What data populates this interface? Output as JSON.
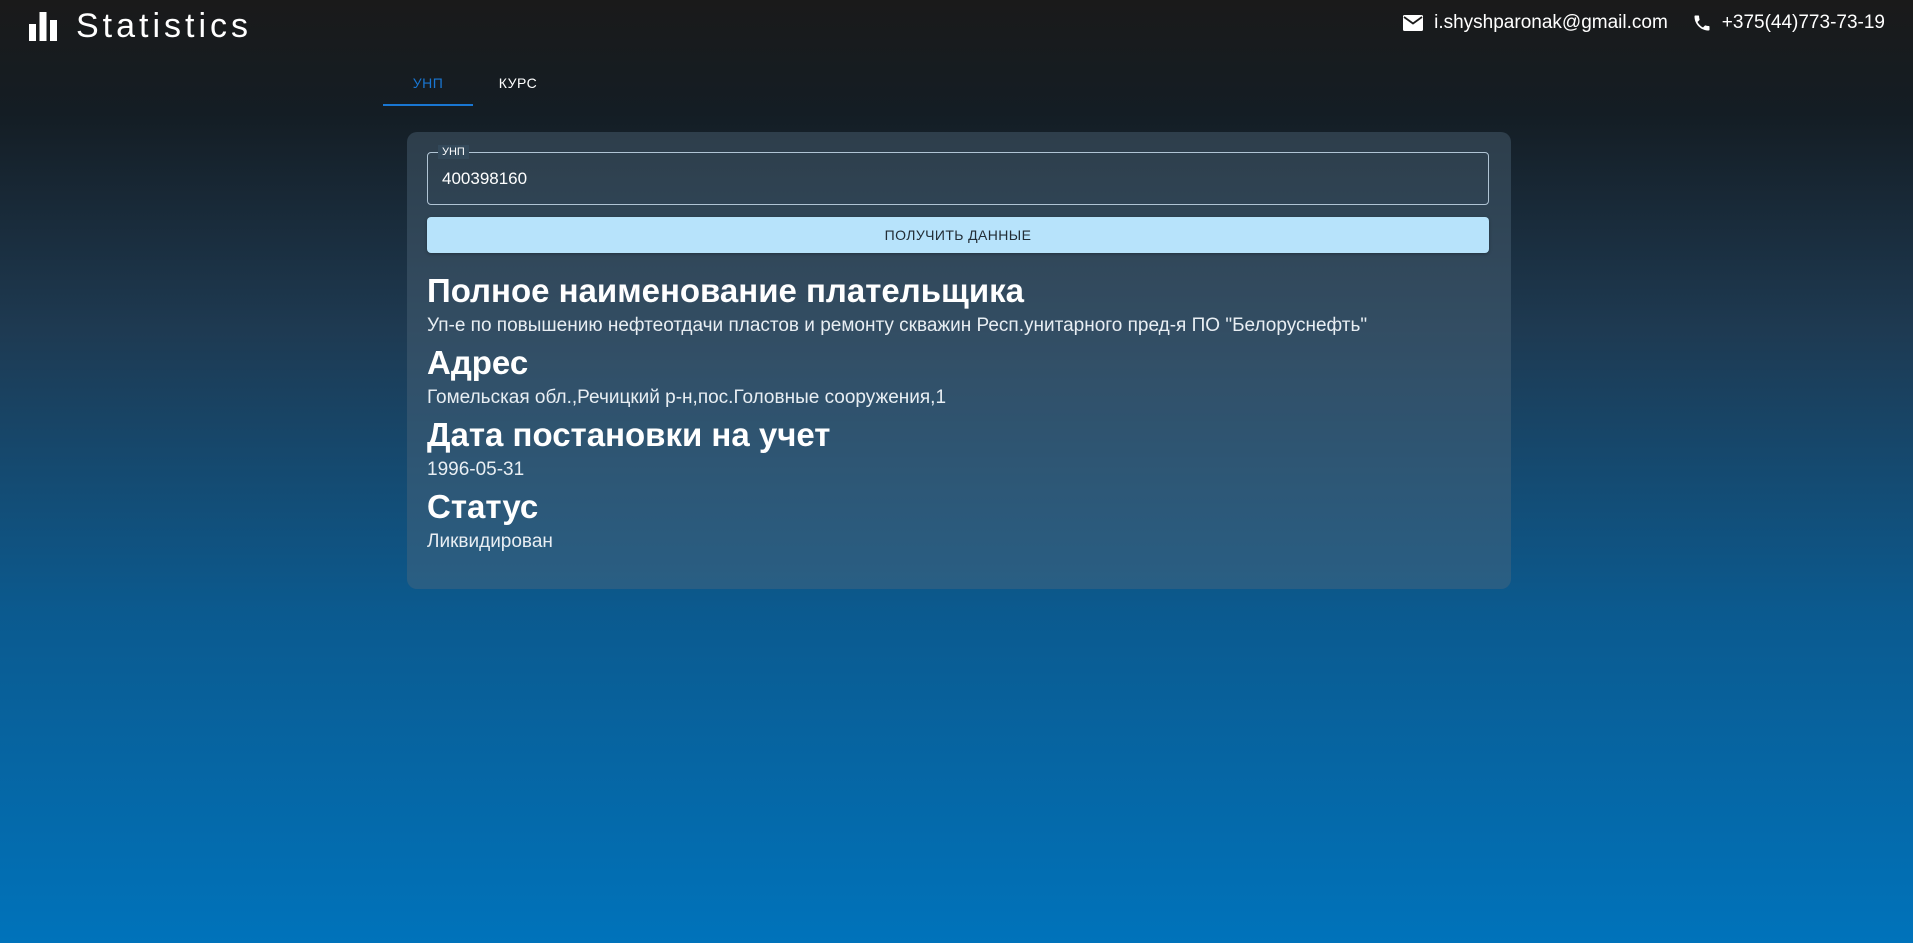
{
  "header": {
    "title": "Statistics",
    "email": "i.shyshparonak@gmail.com",
    "phone": "+375(44)773-73-19"
  },
  "tabs": [
    {
      "label": "УНП",
      "active": true
    },
    {
      "label": "КУРС",
      "active": false
    }
  ],
  "form": {
    "field_label": "УНП",
    "field_value": "400398160",
    "button_label": "ПОЛУЧИТЬ ДАННЫЕ"
  },
  "details": {
    "full_name_heading": "Полное наименование плательщика",
    "full_name_value": "Уп-е по повышению нефтеотдачи пластов и ремонту скважин Респ.унитарного пред-я ПО \"Белоруснефть\"",
    "address_heading": "Адрес",
    "address_value": "Гомельская обл.,Речицкий р-н,пос.Головные сооружения,1",
    "registration_date_heading": "Дата постановки на учет",
    "registration_date_value": "1996-05-31",
    "status_heading": "Статус",
    "status_value": "Ликвидирован"
  },
  "colors": {
    "accent": "#1976d2",
    "button_bg": "#b7e3fb"
  },
  "icons": {
    "logo": "bar-chart-icon",
    "email": "mail-icon",
    "phone": "phone-icon"
  }
}
